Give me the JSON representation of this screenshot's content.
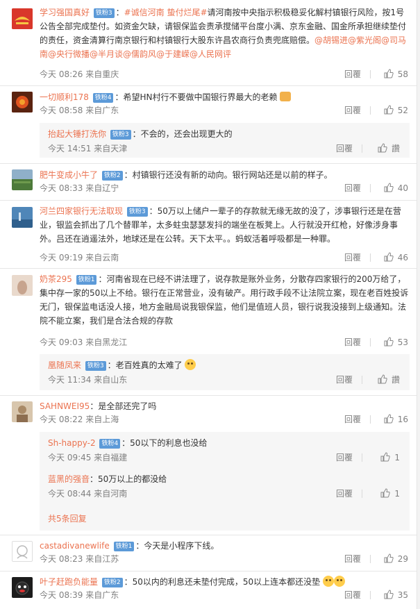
{
  "ui": {
    "reply_label": "回覆",
    "like_label_chinese": "讚",
    "accent_color": "#eb7350",
    "badge_color": "#5c9ad8"
  },
  "comments": [
    {
      "user": "学习强国真好",
      "badge": "铁粉3",
      "text_parts": [
        "：",
        "#诚信河南 蛰付烂尾#",
        "请河南按中央指示积极稳妥化解村镇银行风险，按1号公告全部完成垫付。如资金欠缺，请银保监会责承搅储平台度小满、京东金融、国金所承担继续垫付的责任，资金清算行南京银行和村镇银行大股东许昌农商行负责兜底赔偿。",
        "@胡锡进@紫光阁@司马南@央行微播@半月谈@儒韵风@于建嵘@人民网评"
      ],
      "time": "今天 08:26 来自重庆",
      "likes": "58"
    },
    {
      "user": "一切顺利178",
      "badge": "铁粉4",
      "text": "：希望HN村行不要做中国银行界最大的老赖",
      "time": "今天 08:58 来自广东",
      "likes": "52",
      "replies": [
        {
          "user": "抬起大锤打洗你",
          "badge": "铁粉3",
          "text": "：不会的，还会出现更大的",
          "time": "今天 14:51 来自天津",
          "likes": "讚"
        }
      ]
    },
    {
      "user": "肥牛变成小牛了",
      "badge": "铁粉2",
      "text": "：村镇银行还没有新的动向。银行网站还是以前的样子。",
      "time": "今天 08:33 来自辽宁",
      "likes": "40"
    },
    {
      "user": "河兰四家银行无法取现",
      "badge": "铁粉3",
      "text": "：50万以上储户一辈子的存款就无缘无故的没了，涉事银行还是在营业，银监会抓出了几个替罪羊，太多蛀虫瑟瑟发抖的端坐在板凳上。人行就没开红枪，好像涉身事外。吕还在逍遥法外，地球还是在公转。天下太平。。蚂蚁活着呼吸都是一种罪。",
      "time": "今天 09:19 来自云南",
      "likes": "46"
    },
    {
      "user": "奶茶295",
      "badge": "铁粉1",
      "text": "：河南省现在已经不讲法理了，说存款是账外业务，分散存四家银行的200万给了，集中存一家的50以上不给。银行在正常营业，没有破产。用行政手段不让法院立案，现在老百姓投诉无门，银保监电话没人接，地方金融局说我银保监，他们是值班人员，银行说我没接到上级通知。法院不能立案，我们是合法合规的存款",
      "time": "今天 09:03 来自黑龙江",
      "likes": "53",
      "replies": [
        {
          "user": "凰随凤来",
          "badge": "铁粉3",
          "text": "：老百姓真的太难了",
          "time": "今天 11:34 来自山东",
          "likes": "讚"
        }
      ]
    },
    {
      "user": "SAHNWEI95",
      "text": "：是全部还完了吗",
      "time": "今天 08:22 来自上海",
      "likes": "16",
      "replies": [
        {
          "user": "Sh-happy-2",
          "badge": "铁粉4",
          "text": "：50以下的利息也没给",
          "time": "今天 09:45 来自福建",
          "likes": "1"
        },
        {
          "user": "蓝黑的强音",
          "badge": "",
          "text": "：50万以上的都没给",
          "time": "今天 08:44 来自河南",
          "likes": "1"
        }
      ],
      "more": "共5条回复"
    },
    {
      "user": "castadivanewlife",
      "badge": "铁粉1",
      "text": "：今天是小程序下线。",
      "time": "今天 08:23 来自江苏",
      "likes": "29"
    },
    {
      "user": "叶子赶跑负能量",
      "badge": "铁粉2",
      "text": "：50以内的利息还未垫付完成，50以上连本都还没垫",
      "time": "今天 08:39 来自广东",
      "likes": "35"
    }
  ]
}
